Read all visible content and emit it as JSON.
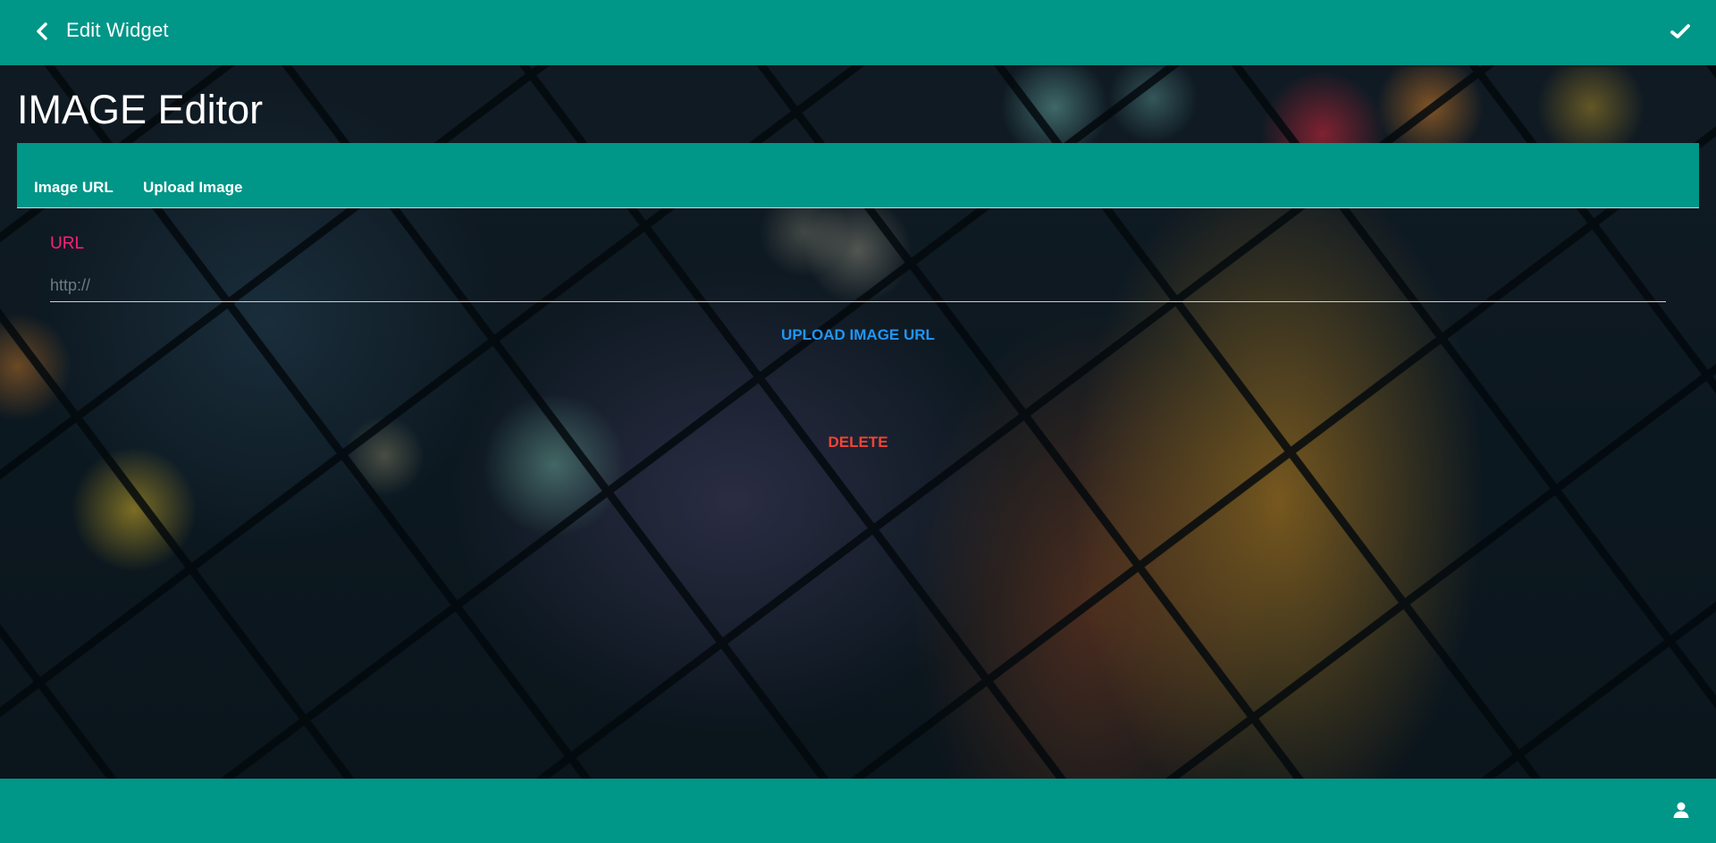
{
  "topbar": {
    "title": "Edit Widget",
    "back_icon": "chevron-left-icon",
    "confirm_icon": "check-icon"
  },
  "editor": {
    "title": "IMAGE Editor"
  },
  "tabs": [
    {
      "label": "Image URL"
    },
    {
      "label": "Upload Image"
    }
  ],
  "form": {
    "url_label": "URL",
    "url_value": "",
    "url_placeholder": "http://",
    "upload_button_label": "UPLOAD IMAGE URL",
    "delete_button_label": "DELETE"
  },
  "bottombar": {
    "user_icon": "user-icon"
  },
  "colors": {
    "primary": "#009688",
    "label_accent": "#ff1f7a",
    "upload_link": "#2196f3",
    "delete": "#f44336"
  }
}
